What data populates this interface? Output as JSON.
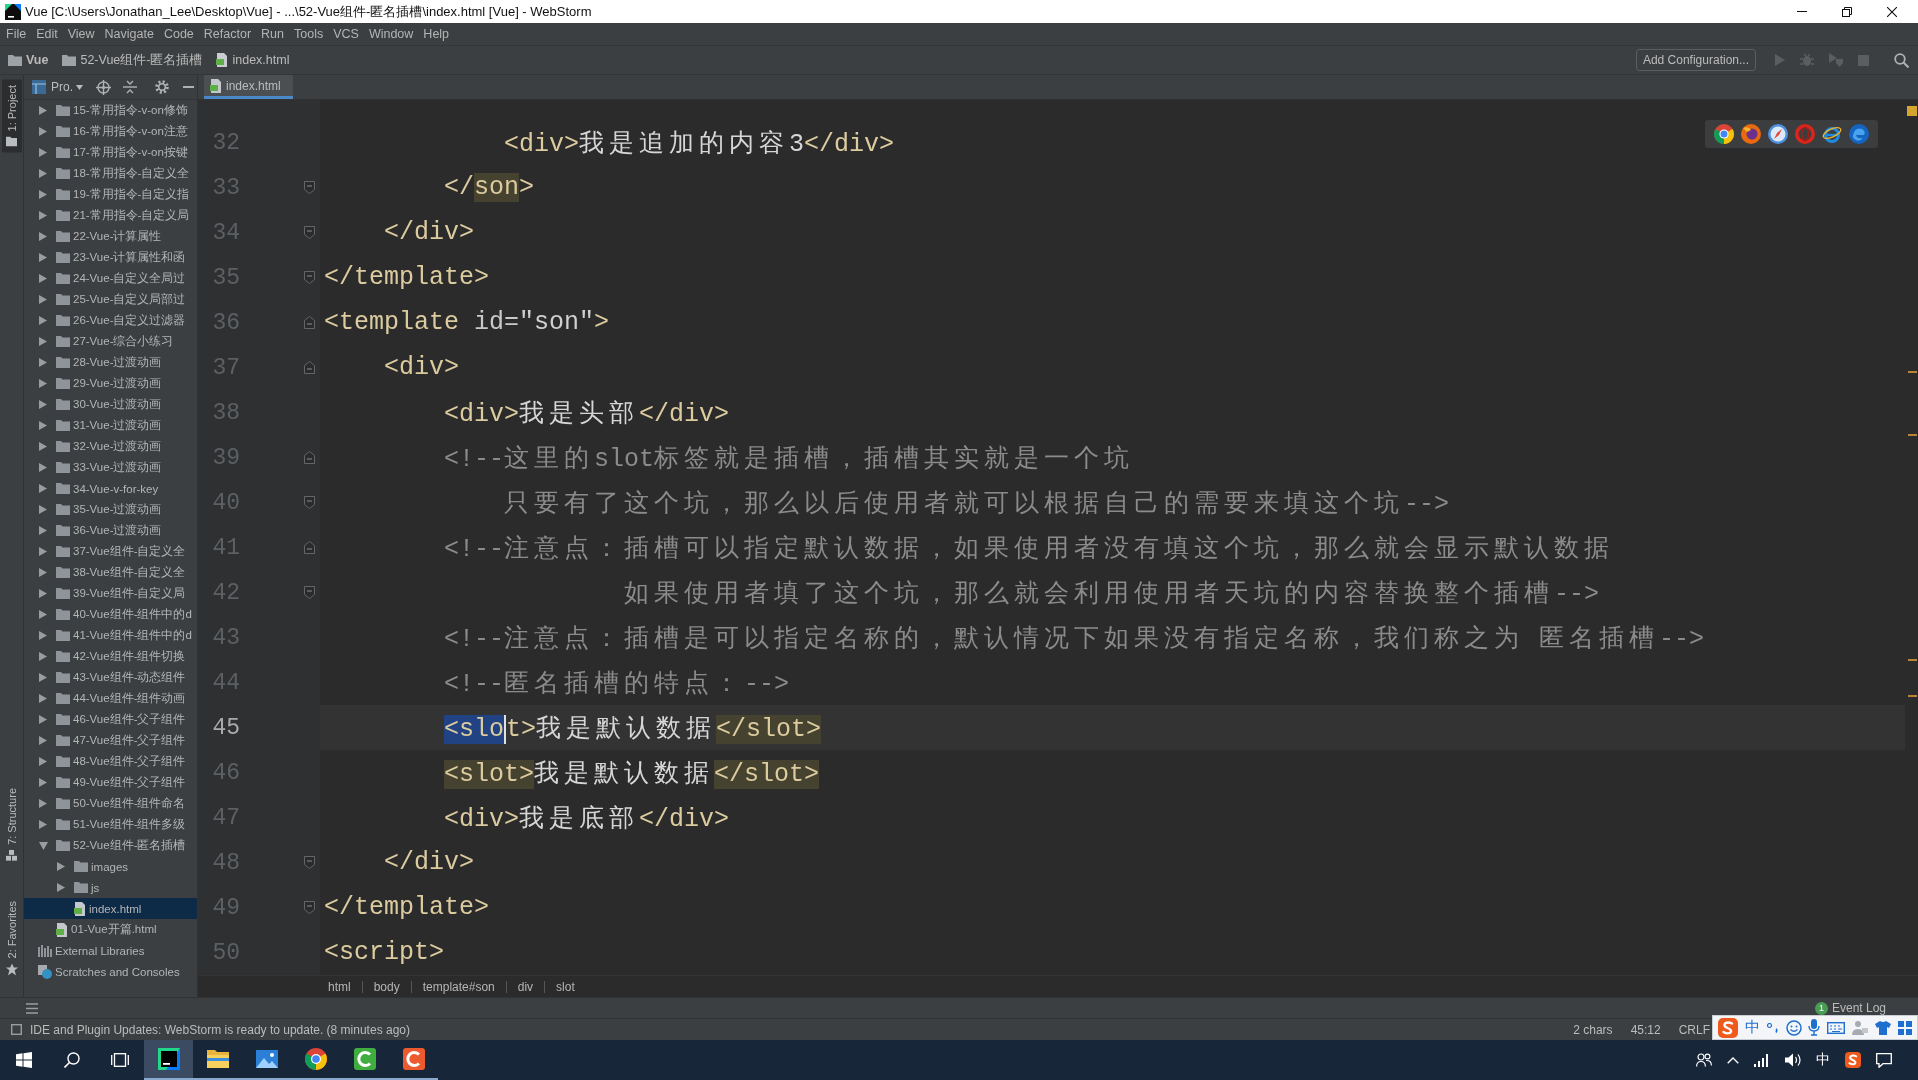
{
  "window": {
    "title": "Vue [C:\\Users\\Jonathan_Lee\\Desktop\\Vue] - ...\\52-Vue组件-匿名插槽\\index.html [Vue] - WebStorm"
  },
  "menu": [
    "File",
    "Edit",
    "View",
    "Navigate",
    "Code",
    "Refactor",
    "Run",
    "Tools",
    "VCS",
    "Window",
    "Help"
  ],
  "navigation_bar": {
    "path": [
      {
        "label": "Vue",
        "kind": "project"
      },
      {
        "label": "52-Vue组件-匿名插槽",
        "kind": "folder"
      },
      {
        "label": "index.html",
        "kind": "html"
      }
    ],
    "run_configuration": "Add Configuration...",
    "actions": [
      {
        "kind": "run",
        "disabled": true
      },
      {
        "kind": "debug",
        "disabled": true
      },
      {
        "kind": "coverage",
        "disabled": true
      },
      {
        "kind": "stop",
        "disabled": true
      },
      {
        "kind": "search",
        "disabled": false
      }
    ]
  },
  "side_tabs": {
    "top": [
      {
        "label": "1: Project",
        "kind": "project",
        "selected": true
      }
    ],
    "bottom": [
      {
        "label": "7: Structure",
        "kind": "structure",
        "selected": false
      },
      {
        "label": "2: Favorites",
        "kind": "favorites",
        "selected": false
      }
    ]
  },
  "project_panel": {
    "view": "Pro.",
    "project_items": [
      {
        "label": "15-常用指令-v-on修饰",
        "kind": "folder",
        "expanded": false,
        "selected": false
      },
      {
        "label": "16-常用指令-v-on注意",
        "kind": "folder",
        "expanded": false,
        "selected": false
      },
      {
        "label": "17-常用指令-v-on按键",
        "kind": "folder",
        "expanded": false,
        "selected": false
      },
      {
        "label": "18-常用指令-自定义全",
        "kind": "folder",
        "expanded": false,
        "selected": false
      },
      {
        "label": "19-常用指令-自定义指",
        "kind": "folder",
        "expanded": false,
        "selected": false
      },
      {
        "label": "21-常用指令-自定义局",
        "kind": "folder",
        "expanded": false,
        "selected": false
      },
      {
        "label": "22-Vue-计算属性",
        "kind": "folder",
        "expanded": false,
        "selected": false
      },
      {
        "label": "23-Vue-计算属性和函",
        "kind": "folder",
        "expanded": false,
        "selected": false
      },
      {
        "label": "24-Vue-自定义全局过",
        "kind": "folder",
        "expanded": false,
        "selected": false
      },
      {
        "label": "25-Vue-自定义局部过",
        "kind": "folder",
        "expanded": false,
        "selected": false
      },
      {
        "label": "26-Vue-自定义过滤器",
        "kind": "folder",
        "expanded": false,
        "selected": false
      },
      {
        "label": "27-Vue-综合小练习",
        "kind": "folder",
        "expanded": false,
        "selected": false
      },
      {
        "label": "28-Vue-过渡动画",
        "kind": "folder",
        "expanded": false,
        "selected": false
      },
      {
        "label": "29-Vue-过渡动画",
        "kind": "folder",
        "expanded": false,
        "selected": false
      },
      {
        "label": "30-Vue-过渡动画",
        "kind": "folder",
        "expanded": false,
        "selected": false
      },
      {
        "label": "31-Vue-过渡动画",
        "kind": "folder",
        "expanded": false,
        "selected": false
      },
      {
        "label": "32-Vue-过渡动画",
        "kind": "folder",
        "expanded": false,
        "selected": false
      },
      {
        "label": "33-Vue-过渡动画",
        "kind": "folder",
        "expanded": false,
        "selected": false
      },
      {
        "label": "34-Vue-v-for-key",
        "kind": "folder",
        "expanded": false,
        "selected": false
      },
      {
        "label": "35-Vue-过渡动画",
        "kind": "folder",
        "expanded": false,
        "selected": false
      },
      {
        "label": "36-Vue-过渡动画",
        "kind": "folder",
        "expanded": false,
        "selected": false
      },
      {
        "label": "37-Vue组件-自定义全",
        "kind": "folder",
        "expanded": false,
        "selected": false
      },
      {
        "label": "38-Vue组件-自定义全",
        "kind": "folder",
        "expanded": false,
        "selected": false
      },
      {
        "label": "39-Vue组件-自定义局",
        "kind": "folder",
        "expanded": false,
        "selected": false
      },
      {
        "label": "40-Vue组件-组件中的d",
        "kind": "folder",
        "expanded": false,
        "selected": false
      },
      {
        "label": "41-Vue组件-组件中的d",
        "kind": "folder",
        "expanded": false,
        "selected": false
      },
      {
        "label": "42-Vue组件-组件切换",
        "kind": "folder",
        "expanded": false,
        "selected": false
      },
      {
        "label": "43-Vue组件-动态组件",
        "kind": "folder",
        "expanded": false,
        "selected": false
      },
      {
        "label": "44-Vue组件-组件动画",
        "kind": "folder",
        "expanded": false,
        "selected": false
      },
      {
        "label": "46-Vue组件-父子组件",
        "kind": "folder",
        "expanded": false,
        "selected": false
      },
      {
        "label": "47-Vue组件-父子组件",
        "kind": "folder",
        "expanded": false,
        "selected": false
      },
      {
        "label": "48-Vue组件-父子组件",
        "kind": "folder",
        "expanded": false,
        "selected": false
      },
      {
        "label": "49-Vue组件-父子组件",
        "kind": "folder",
        "expanded": false,
        "selected": false
      },
      {
        "label": "50-Vue组件-组件命名",
        "kind": "folder",
        "expanded": false,
        "selected": false
      },
      {
        "label": "51-Vue组件-组件多级",
        "kind": "folder",
        "expanded": false,
        "selected": false
      },
      {
        "label": "52-Vue组件-匿名插槽",
        "kind": "folder",
        "expanded": true,
        "selected": false,
        "children": [
          {
            "label": "images",
            "kind": "folder",
            "expanded": false,
            "selected": false
          },
          {
            "label": "js",
            "kind": "folder",
            "expanded": false,
            "selected": false
          },
          {
            "label": "index.html",
            "kind": "html",
            "selected": true
          }
        ]
      },
      {
        "label": "01-Vue开篇.html",
        "kind": "html",
        "selected": false
      }
    ],
    "root_items": [
      {
        "label": "External Libraries",
        "kind": "libraries",
        "selected": false
      },
      {
        "label": "Scratches and Consoles",
        "kind": "scratches",
        "selected": false
      }
    ]
  },
  "editor_tabs": [
    {
      "label": "index.html",
      "selected": true
    }
  ],
  "editor": {
    "lines": [
      {
        "number": "32",
        "kind": "plain",
        "current": false,
        "tokens": [
          {
            "text": "            <div>",
            "kind": "tag"
          },
          {
            "text": "我是追加的内容3",
            "kind": "text"
          },
          {
            "text": "</div>",
            "kind": "tag"
          }
        ]
      },
      {
        "number": "33",
        "kind": "closing",
        "current": false,
        "tokens": [
          {
            "text": "        </",
            "kind": "tag"
          },
          {
            "text": "son",
            "kind": "paired"
          },
          {
            "text": ">",
            "kind": "tag"
          }
        ]
      },
      {
        "number": "34",
        "kind": "closing",
        "current": false,
        "tokens": [
          {
            "text": "    </div>",
            "kind": "tag"
          }
        ]
      },
      {
        "number": "35",
        "kind": "closing",
        "current": false,
        "tokens": [
          {
            "text": "</template>",
            "kind": "tag"
          }
        ]
      },
      {
        "number": "36",
        "kind": "opening",
        "current": false,
        "tokens": [
          {
            "text": "<template ",
            "kind": "tag"
          },
          {
            "text": "id=",
            "kind": "attr"
          },
          {
            "text": "\"son\"",
            "kind": "value"
          },
          {
            "text": ">",
            "kind": "tag"
          }
        ]
      },
      {
        "number": "37",
        "kind": "opening",
        "current": false,
        "tokens": [
          {
            "text": "    <div>",
            "kind": "tag"
          }
        ]
      },
      {
        "number": "38",
        "kind": "plain",
        "current": false,
        "tokens": [
          {
            "text": "        <div>",
            "kind": "tag"
          },
          {
            "text": "我是头部",
            "kind": "text"
          },
          {
            "text": "</div>",
            "kind": "tag"
          }
        ]
      },
      {
        "number": "39",
        "kind": "opening",
        "current": false,
        "tokens": [
          {
            "text": "        <!--这里的slot标签就是插槽，插槽其实就是一个坑",
            "kind": "comment"
          }
        ]
      },
      {
        "number": "40",
        "kind": "closing",
        "current": false,
        "tokens": [
          {
            "text": "            只要有了这个坑，那么以后使用者就可以根据自己的需要来填这个坑-->",
            "kind": "comment"
          }
        ]
      },
      {
        "number": "41",
        "kind": "opening",
        "current": false,
        "tokens": [
          {
            "text": "        <!--注意点：插槽可以指定默认数据，如果使用者没有填这个坑，那么就会显示默认数据",
            "kind": "comment"
          }
        ]
      },
      {
        "number": "42",
        "kind": "closing",
        "current": false,
        "tokens": [
          {
            "text": "                    如果使用者填了这个坑，那么就会利用使用者天坑的内容替换整个插槽-->",
            "kind": "comment"
          }
        ]
      },
      {
        "number": "43",
        "kind": "plain",
        "current": false,
        "tokens": [
          {
            "text": "        <!--注意点：插槽是可以指定名称的，默认情况下如果没有指定名称，我们称之为 匿名插槽-->",
            "kind": "comment"
          }
        ]
      },
      {
        "number": "44",
        "kind": "plain",
        "current": false,
        "tokens": [
          {
            "text": "        <!--匿名插槽的特点：-->",
            "kind": "comment"
          }
        ]
      },
      {
        "number": "45",
        "kind": "plain",
        "current": true,
        "tokens": [
          {
            "text": "        <slo",
            "kind": "selected"
          },
          {
            "text": "t>",
            "kind": "tag"
          },
          {
            "text": "我是默认数据",
            "kind": "text"
          },
          {
            "text": "</slot>",
            "kind": "paired"
          }
        ]
      },
      {
        "number": "46",
        "kind": "plain",
        "current": false,
        "tokens": [
          {
            "text": "        <slot>",
            "kind": "paired"
          },
          {
            "text": "我是默认数据",
            "kind": "text"
          },
          {
            "text": "</slot>",
            "kind": "paired"
          }
        ]
      },
      {
        "number": "47",
        "kind": "plain",
        "current": false,
        "tokens": [
          {
            "text": "        <div>",
            "kind": "tag"
          },
          {
            "text": "我是底部",
            "kind": "text"
          },
          {
            "text": "</div>",
            "kind": "tag"
          }
        ]
      },
      {
        "number": "48",
        "kind": "closing",
        "current": false,
        "tokens": [
          {
            "text": "    </div>",
            "kind": "tag"
          }
        ]
      },
      {
        "number": "49",
        "kind": "closing",
        "current": false,
        "tokens": [
          {
            "text": "</template>",
            "kind": "tag"
          }
        ]
      },
      {
        "number": "50",
        "kind": "plain",
        "current": false,
        "tokens": [
          {
            "text": "<script>",
            "kind": "tag"
          }
        ]
      }
    ]
  },
  "breadcrumbs": [
    "html",
    "body",
    "template#son",
    "div",
    "slot"
  ],
  "event_log": {
    "label": "Event Log",
    "count": "1"
  },
  "status_bar": {
    "message": "IDE and Plugin Updates: WebStorm is ready to update. (8 minutes ago)",
    "selection": "2 chars",
    "position": "45:12",
    "line_separator": "CRLF"
  },
  "ime_bar": {
    "mode": "中"
  },
  "taskbar": {
    "apps": [
      {
        "kind": "ide",
        "selected": true
      },
      {
        "kind": "files",
        "selected": false
      },
      {
        "kind": "gallery",
        "selected": false
      },
      {
        "kind": "browser",
        "selected": false
      },
      {
        "kind": "recorder",
        "selected": false
      },
      {
        "kind": "capture",
        "selected": false
      }
    ],
    "tray_ime": "中"
  }
}
